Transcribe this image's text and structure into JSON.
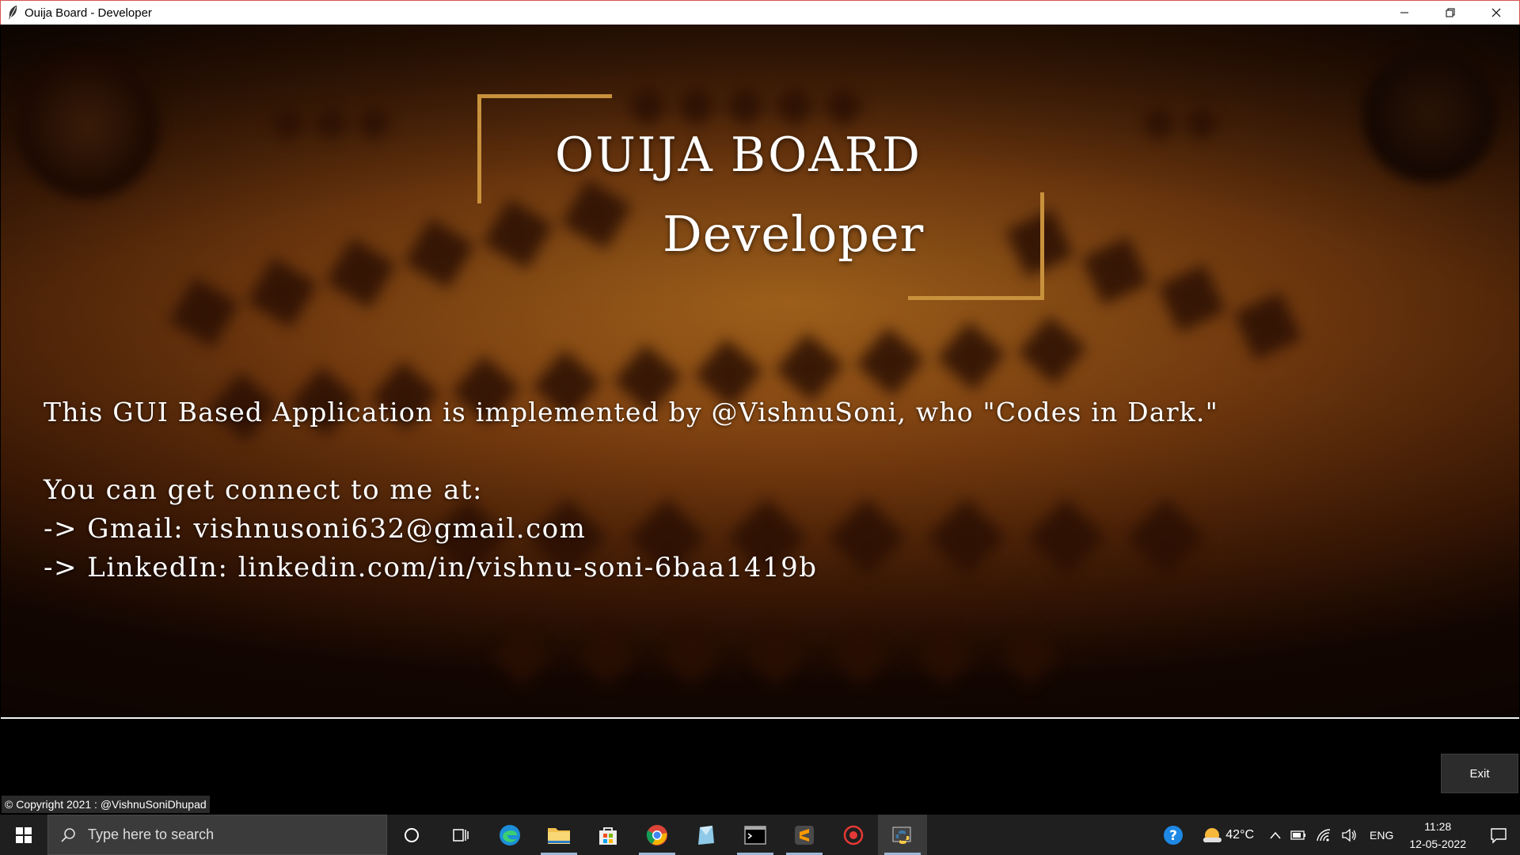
{
  "window": {
    "title": "Ouija Board - Developer"
  },
  "content": {
    "heading": "OUIJA BOARD",
    "subheading": "Developer",
    "intro": "This GUI Based Application is implemented by @VishnuSoni, who \"Codes in Dark.\"",
    "connect_label": "You can get connect to me at:",
    "gmail_line": "-> Gmail: vishnusoni632@gmail.com",
    "linkedin_line": "-> LinkedIn: linkedin.com/in/vishnu-soni-6baa1419b"
  },
  "footer": {
    "exit_label": "Exit",
    "copyright": "© Copyright 2021 : @VishnuSoniDhupad"
  },
  "taskbar": {
    "search_placeholder": "Type here to search",
    "temperature": "42°C",
    "language": "ENG",
    "time": "11:28",
    "date": "12-05-2022"
  },
  "colors": {
    "frame_accent": "#c8913c",
    "board_glow": "#a7651c",
    "taskbar_bg": "#1f1f1f"
  }
}
